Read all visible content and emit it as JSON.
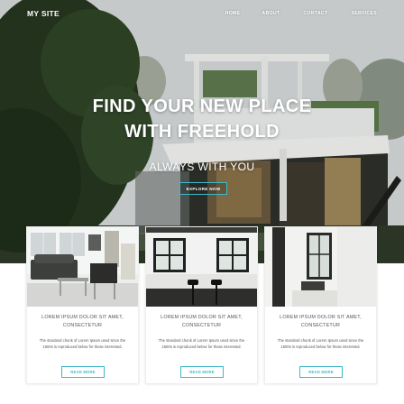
{
  "brand": {
    "logo": "MY SITE",
    "accent": "#3fb8c8"
  },
  "nav": {
    "home": "HOME",
    "about": "ABOUT",
    "contact": "CONTACT",
    "services": "SERVICES"
  },
  "hero": {
    "title_line1": "FIND YOUR NEW PLACE",
    "title_line2": "WITH FREEHOLD",
    "subtitle": "ALWAYS WITH YOU",
    "cta": "EXPLORE NOW"
  },
  "cards": [
    {
      "title": "LOREM IPSUM DOLOR SIT AMET, CONSECTETUR",
      "text": "The standard chunk of Lorem Ipsum used since the 1500s is reproduced below for those interested.",
      "button": "READ MORE"
    },
    {
      "title": "LOREM IPSUM DOLOR SIT AMET, CONSECTETUR",
      "text": "The standard chunk of Lorem Ipsum used since the 1500s is reproduced below for those interested.",
      "button": "READ MORE"
    },
    {
      "title": "LOREM IPSUM DOLOR SIT AMET, CONSECTETUR",
      "text": "The standard chunk of Lorem Ipsum used since the 1500s is reproduced below for those interested.",
      "button": "READ MORE"
    }
  ]
}
